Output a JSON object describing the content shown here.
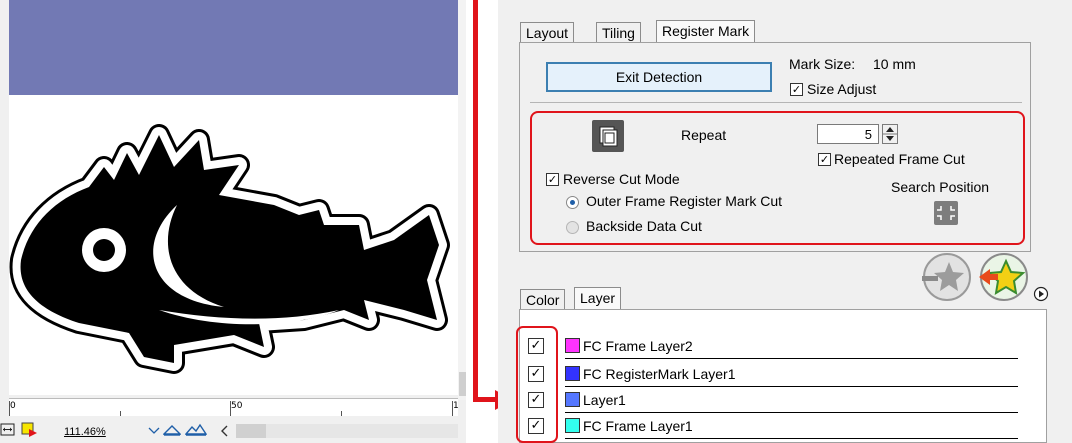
{
  "canvas": {
    "ruler_labels": [
      "0",
      "50",
      "1"
    ],
    "zoom_value": "111.46%",
    "icons": [
      "fit-width-icon",
      "color-icon",
      "dropdown-icon",
      "view-icon",
      "view-alt-icon",
      "scroll-left-icon",
      "scroll-right-icon"
    ]
  },
  "tabs_top": {
    "layout": "Layout",
    "tiling": "Tiling",
    "register_mark": "Register Mark"
  },
  "register_mark": {
    "exit_detection": "Exit Detection",
    "mark_size_label": "Mark Size:",
    "mark_size_value": "10 mm",
    "size_adjust_label": "Size Adjust",
    "size_adjust_checked": true,
    "repeat_label": "Repeat",
    "repeat_value": "5",
    "repeated_frame_cut_label": "Repeated Frame Cut",
    "repeated_frame_cut_checked": true,
    "reverse_cut_mode_label": "Reverse Cut Mode",
    "reverse_cut_mode_checked": true,
    "outer_frame_label": "Outer Frame Register Mark Cut",
    "backside_label": "Backside Data Cut",
    "selected_mode": "Outer Frame Register Mark Cut",
    "search_position_label": "Search Position"
  },
  "tabs_bottom": {
    "color": "Color",
    "layer": "Layer"
  },
  "layers": [
    {
      "name": "FC Frame Layer2",
      "checked": true,
      "color": "#ff33ff"
    },
    {
      "name": "FC RegisterMark Layer1",
      "checked": true,
      "color": "#3333ff"
    },
    {
      "name": "Layer1",
      "checked": true,
      "color": "#5577ff"
    },
    {
      "name": "FC Frame Layer1",
      "checked": true,
      "color": "#33ffee"
    }
  ],
  "check_mark": "✓",
  "colors": {
    "header_band": "#7279b4",
    "highlight_red": "#e0141b",
    "focus_blue": "#3c7fb1"
  }
}
